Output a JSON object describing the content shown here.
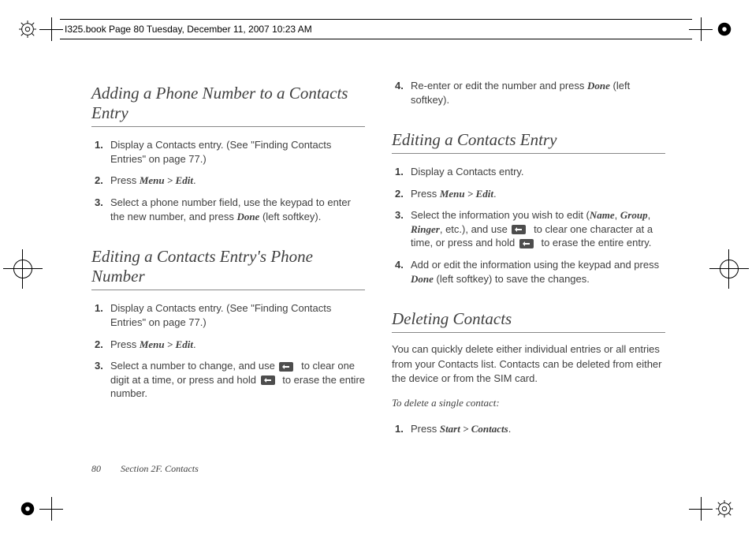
{
  "doc_header": "I325.book  Page 80  Tuesday, December 11, 2007  10:23 AM",
  "footer": {
    "page_number": "80",
    "section": "Section 2F. Contacts"
  },
  "left_col": {
    "section1": {
      "title": "Adding a Phone Number to a Contacts Entry",
      "steps": [
        {
          "n": "1.",
          "pre": "Display a Contacts entry. (See \"Finding Contacts Entries\" on page 77.)"
        },
        {
          "n": "2.",
          "pre": "Press ",
          "emph": "Menu > Edit",
          "post": "."
        },
        {
          "n": "3.",
          "pre": "Select a phone number field, use the keypad to enter the new number, and press ",
          "emph": "Done",
          "post": " (left softkey)."
        }
      ]
    },
    "section2": {
      "title": "Editing a Contacts Entry's Phone Number",
      "steps": [
        {
          "n": "1.",
          "pre": "Display a Contacts entry. (See \"Finding Contacts Entries\" on page 77.)"
        },
        {
          "n": "2.",
          "pre": "Press ",
          "emph": "Menu > Edit",
          "post": "."
        },
        {
          "n": "3.",
          "pre": "Select a number to change, and use ",
          "icon1": true,
          "mid": " to clear one digit at a time, or press and hold ",
          "icon2": true,
          "post": " to erase the entire number."
        }
      ]
    }
  },
  "right_col": {
    "cont_step": {
      "n": "4.",
      "pre": "Re-enter or edit the number and press ",
      "emph": "Done",
      "post": " (left softkey)."
    },
    "section3": {
      "title": "Editing a Contacts Entry",
      "steps": [
        {
          "n": "1.",
          "pre": "Display a Contacts entry."
        },
        {
          "n": "2.",
          "pre": "Press ",
          "emph": "Menu > Edit",
          "post": "."
        },
        {
          "n": "3.",
          "pre": "Select the information you wish to edit (",
          "emph": "Name",
          "mid1": ", ",
          "emph2": "Group",
          "mid2": ", ",
          "emph3": "Ringer",
          "mid3": ", etc.), and use ",
          "icon1": true,
          "mid4": " to clear one character at a time, or press and hold ",
          "icon2": true,
          "post": " to erase the entire entry."
        },
        {
          "n": "4.",
          "pre": "Add or edit the information using the keypad and press ",
          "emph": "Done",
          "post": " (left softkey) to save the changes."
        }
      ]
    },
    "section4": {
      "title": "Deleting Contacts",
      "body": "You can quickly delete either individual entries or all entries from your Contacts list. Contacts can be deleted from either the device or from the SIM card.",
      "subhead": "To delete a single contact:",
      "steps": [
        {
          "n": "1.",
          "pre": "Press ",
          "emph": "Start > Contacts",
          "post": "."
        }
      ]
    }
  }
}
